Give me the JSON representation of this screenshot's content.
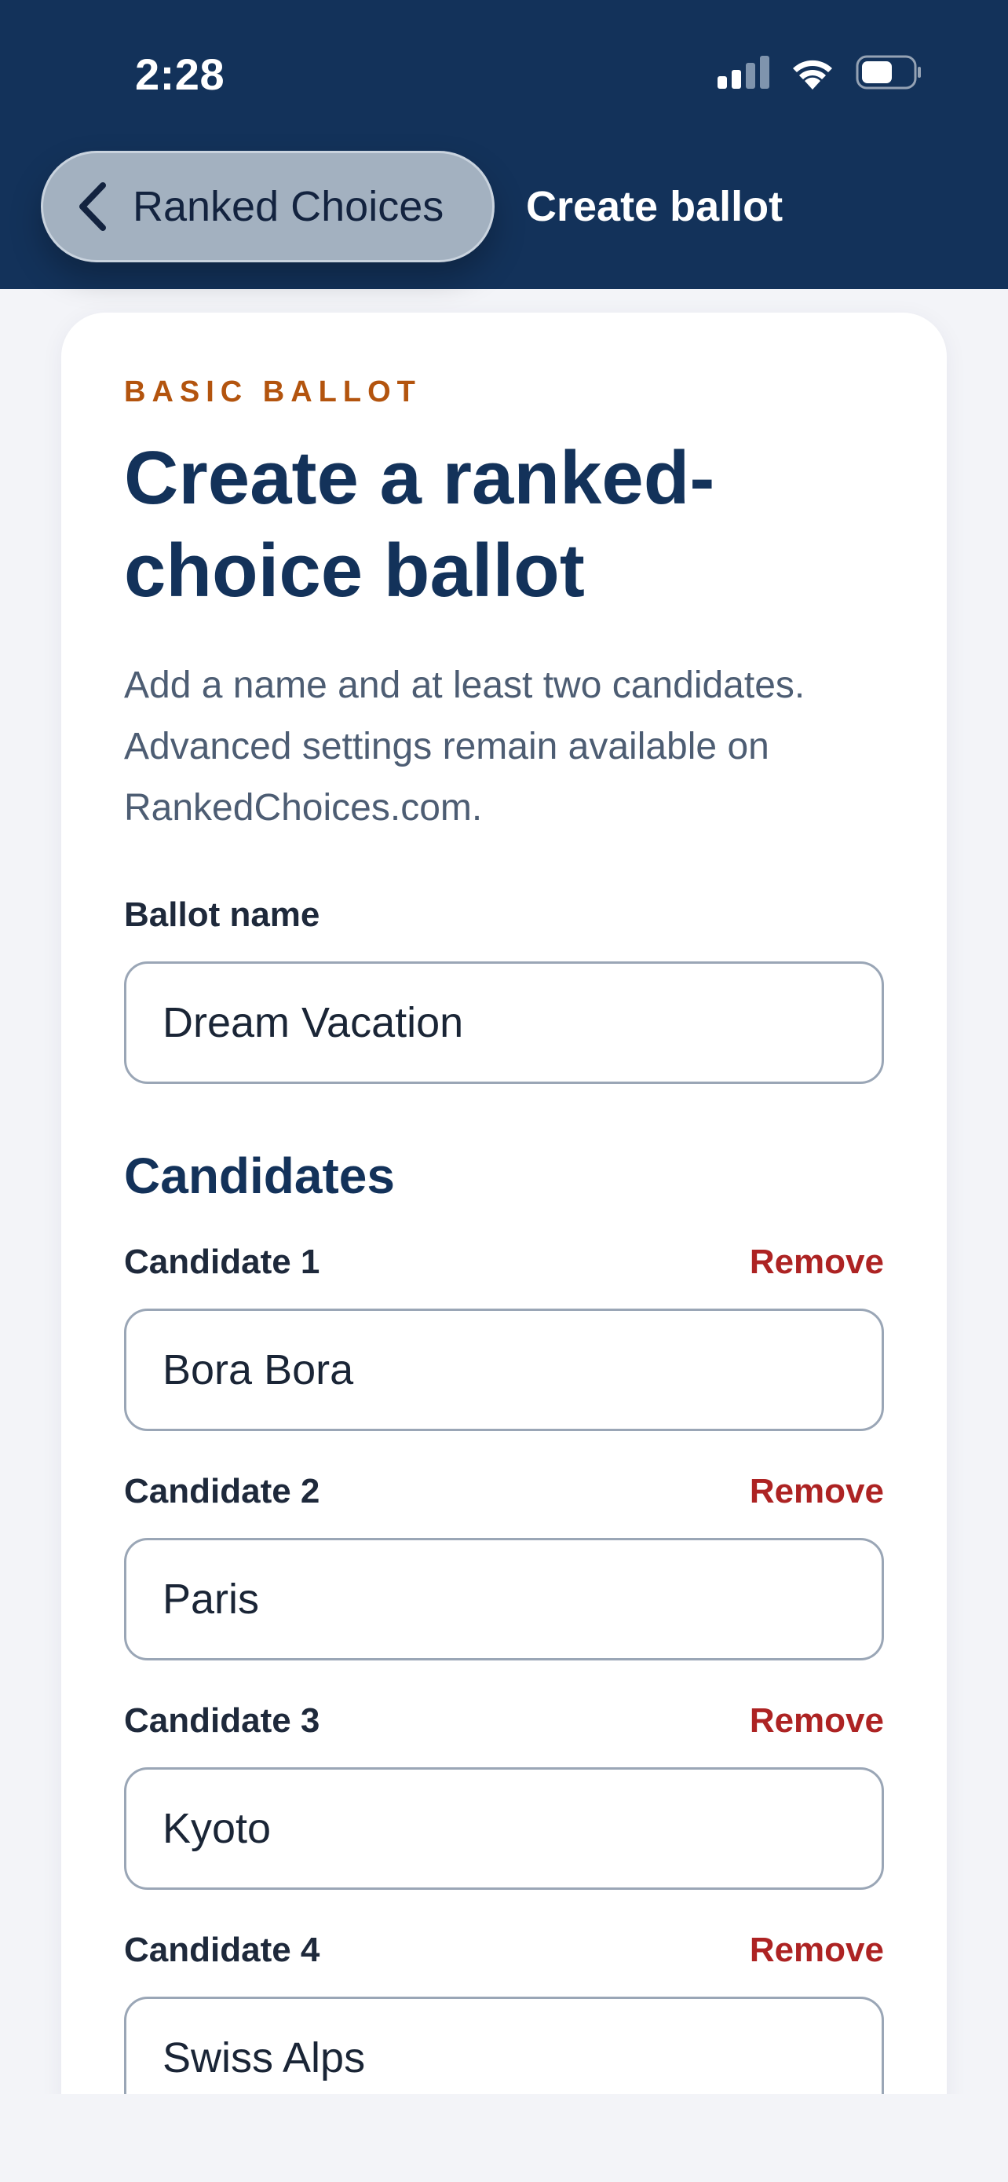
{
  "status_bar": {
    "time": "2:28",
    "icons": [
      "cellular-signal-icon",
      "wifi-icon",
      "battery-icon"
    ]
  },
  "header": {
    "back_label": "Ranked Choices",
    "title": "Create ballot"
  },
  "form": {
    "eyebrow": "BASIC BALLOT",
    "title": "Create a ranked-choice ballot",
    "intro": "Add a name and at least two candidates. Advanced settings remain available on RankedChoices.com.",
    "ballot_name_label": "Ballot name",
    "ballot_name_value": "Dream Vacation",
    "candidates_heading": "Candidates",
    "remove_label": "Remove",
    "candidates": [
      {
        "label": "Candidate 1",
        "value": "Bora Bora"
      },
      {
        "label": "Candidate 2",
        "value": "Paris"
      },
      {
        "label": "Candidate 3",
        "value": "Kyoto"
      },
      {
        "label": "Candidate 4",
        "value": "Swiss Alps"
      }
    ]
  },
  "colors": {
    "header_bg": "#13325a",
    "eyebrow": "#b3540e",
    "remove": "#ad2323",
    "page_bg": "#f3f4f8"
  }
}
